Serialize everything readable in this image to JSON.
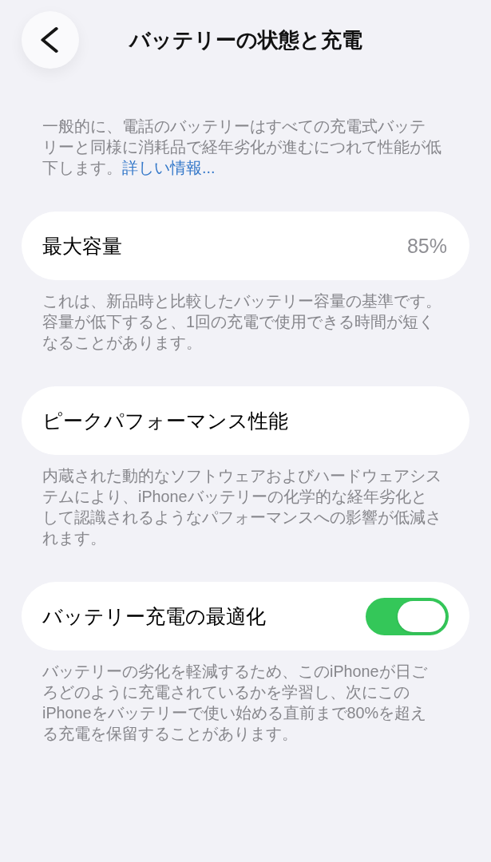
{
  "header": {
    "title": "バッテリーの状態と充電"
  },
  "intro": {
    "text": "一般的に、電話のバッテリーはすべての充電式バッテリーと同様に消耗品で経年劣化が進むにつれて性能が低下します。",
    "link": "詳しい情報..."
  },
  "sections": [
    {
      "kind": "value",
      "label": "最大容量",
      "value": "85%",
      "footer": "これは、新品時と比較したバッテリー容量の基準です。容量が低下すると、1回の充電で使用できる時間が短くなることがあります。"
    },
    {
      "kind": "plain",
      "label": "ピークパフォーマンス性能",
      "footer": "内蔵された動的なソフトウェアおよびハードウェアシステムにより、iPhoneバッテリーの化学的な経年劣化として認識されるようなパフォーマンスへの影響が低減されます。"
    },
    {
      "kind": "toggle",
      "label": "バッテリー充電の最適化",
      "on": true,
      "footer": "バッテリーの劣化を軽減するため、このiPhoneが日ごろどのように充電されているかを学習し、次にこのiPhoneをバッテリーで使い始める直前まで80%を超える充電を保留することがあります。"
    }
  ]
}
